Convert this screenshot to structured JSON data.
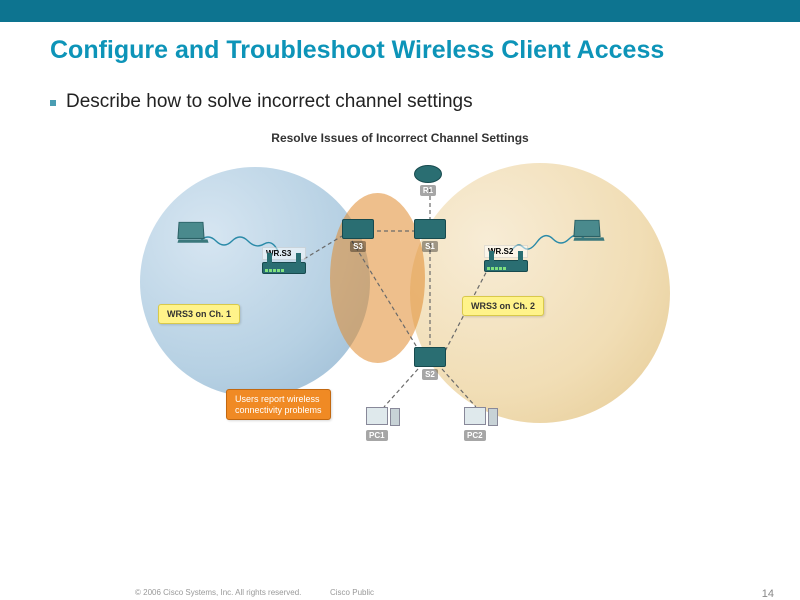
{
  "header": {
    "title": "Configure and Troubleshoot Wireless Client Access"
  },
  "bullet": {
    "text": "Describe how to solve incorrect channel settings"
  },
  "diagram": {
    "title": "Resolve Issues of Incorrect Channel Settings",
    "devices": {
      "r1": "R1",
      "s1": "S1",
      "s2": "S2",
      "s3": "S3",
      "pc1": "PC1",
      "pc2": "PC2",
      "wrs3": "WR.S3",
      "wrs2": "WR.S2"
    },
    "tags": {
      "left": "WRS3 on Ch. 1",
      "right": "WRS3 on Ch. 2",
      "problem_l1": "Users report wireless",
      "problem_l2": "connectivity problems"
    }
  },
  "chart_data": {
    "type": "table",
    "title": "Resolve Issues of Incorrect Channel Settings",
    "nodes": [
      {
        "id": "R1",
        "type": "router"
      },
      {
        "id": "S1",
        "type": "switch"
      },
      {
        "id": "S2",
        "type": "switch"
      },
      {
        "id": "S3",
        "type": "switch"
      },
      {
        "id": "WR.S3",
        "type": "wireless-router",
        "channel": 1,
        "coverage": "left"
      },
      {
        "id": "WR.S2",
        "type": "wireless-router",
        "channel": 2,
        "coverage": "right"
      },
      {
        "id": "PC1",
        "type": "pc"
      },
      {
        "id": "PC2",
        "type": "pc"
      },
      {
        "id": "LaptopLeft",
        "type": "laptop",
        "wireless_assoc": "WR.S3"
      },
      {
        "id": "LaptopRight",
        "type": "laptop",
        "wireless_assoc": "WR.S2"
      }
    ],
    "links": [
      {
        "from": "R1",
        "to": "S1",
        "type": "wired"
      },
      {
        "from": "S1",
        "to": "S2",
        "type": "wired"
      },
      {
        "from": "S1",
        "to": "S3",
        "type": "wired"
      },
      {
        "from": "S2",
        "to": "S3",
        "type": "wired"
      },
      {
        "from": "S2",
        "to": "PC1",
        "type": "wired"
      },
      {
        "from": "S2",
        "to": "PC2",
        "type": "wired"
      },
      {
        "from": "S3",
        "to": "WR.S3",
        "type": "wired"
      },
      {
        "from": "S2",
        "to": "WR.S2",
        "type": "wired"
      },
      {
        "from": "LaptopLeft",
        "to": "WR.S3",
        "type": "wireless"
      },
      {
        "from": "LaptopRight",
        "to": "WR.S2",
        "type": "wireless"
      }
    ],
    "annotation": "Users report wireless connectivity problems",
    "overlap_region": "Channel interference zone between WRS3 (Ch.1) and WRS2 (Ch.2) coverage"
  },
  "footer": {
    "copyright": "© 2006 Cisco Systems, Inc. All rights reserved.",
    "classification": "Cisco Public",
    "page": "14"
  }
}
